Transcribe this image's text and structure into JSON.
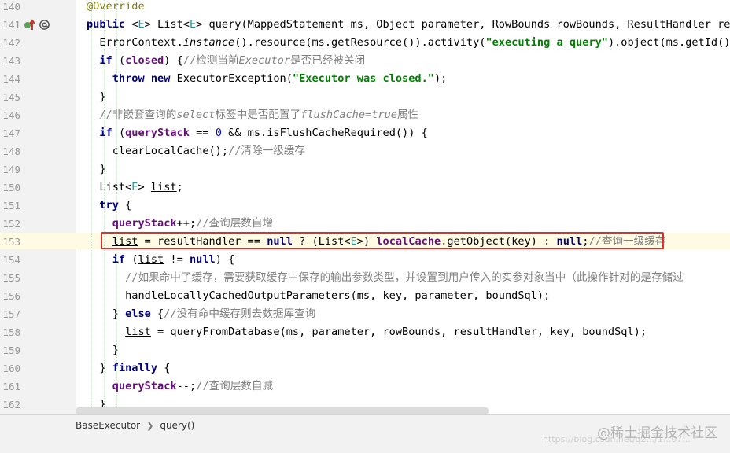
{
  "editor": {
    "lines": [
      {
        "n": "140",
        "segs": [
          {
            "t": "@Override",
            "c": "ann"
          }
        ]
      },
      {
        "n": "141",
        "segs": [
          {
            "t": "public ",
            "c": "kw"
          },
          {
            "t": "<",
            "c": ""
          },
          {
            "t": "E",
            "c": "gen"
          },
          {
            "t": "> List<",
            "c": ""
          },
          {
            "t": "E",
            "c": "gen"
          },
          {
            "t": "> query(MappedStatement ms, Object parameter, RowBounds rowBounds, ResultHandler resul",
            "c": ""
          }
        ]
      },
      {
        "n": "142",
        "segs": [
          {
            "t": "  ErrorContext.",
            "c": ""
          },
          {
            "t": "instance",
            "c": "it"
          },
          {
            "t": "().resource(ms.getResource()).activity(",
            "c": ""
          },
          {
            "t": "\"executing a query\"",
            "c": "str"
          },
          {
            "t": ").object(ms.getId());",
            "c": ""
          }
        ]
      },
      {
        "n": "143",
        "segs": [
          {
            "t": "  ",
            "c": ""
          },
          {
            "t": "if ",
            "c": "kw"
          },
          {
            "t": "(",
            "c": ""
          },
          {
            "t": "closed",
            "c": "fld"
          },
          {
            "t": ") {",
            "c": ""
          },
          {
            "t": "//检测当前",
            "c": "cmz"
          },
          {
            "t": "Executor",
            "c": "cm"
          },
          {
            "t": "是否已经被关闭",
            "c": "cmz"
          }
        ]
      },
      {
        "n": "144",
        "segs": [
          {
            "t": "    ",
            "c": ""
          },
          {
            "t": "throw new ",
            "c": "kw"
          },
          {
            "t": "ExecutorException(",
            "c": ""
          },
          {
            "t": "\"Executor was closed.\"",
            "c": "str"
          },
          {
            "t": ");",
            "c": ""
          }
        ]
      },
      {
        "n": "145",
        "segs": [
          {
            "t": "  }",
            "c": ""
          }
        ]
      },
      {
        "n": "146",
        "segs": [
          {
            "t": "  //非嵌套查询的",
            "c": "cmz"
          },
          {
            "t": "select",
            "c": "cm"
          },
          {
            "t": "标签中是否配置了",
            "c": "cmz"
          },
          {
            "t": "flushCache=true",
            "c": "cm"
          },
          {
            "t": "属性",
            "c": "cmz"
          }
        ]
      },
      {
        "n": "147",
        "segs": [
          {
            "t": "  ",
            "c": ""
          },
          {
            "t": "if ",
            "c": "kw"
          },
          {
            "t": "(",
            "c": ""
          },
          {
            "t": "queryStack",
            "c": "fld"
          },
          {
            "t": " == ",
            "c": ""
          },
          {
            "t": "0",
            "c": "num"
          },
          {
            "t": " && ms.isFlushCacheRequired()) {",
            "c": ""
          }
        ]
      },
      {
        "n": "148",
        "segs": [
          {
            "t": "    clearLocalCache();",
            "c": ""
          },
          {
            "t": "//清除一级缓存",
            "c": "cmz"
          }
        ]
      },
      {
        "n": "149",
        "segs": [
          {
            "t": "  }",
            "c": ""
          }
        ]
      },
      {
        "n": "150",
        "segs": [
          {
            "t": "  List<",
            "c": ""
          },
          {
            "t": "E",
            "c": "gen"
          },
          {
            "t": "> ",
            "c": ""
          },
          {
            "t": "list",
            "c": "ul"
          },
          {
            "t": ";",
            "c": ""
          }
        ]
      },
      {
        "n": "151",
        "segs": [
          {
            "t": "  ",
            "c": ""
          },
          {
            "t": "try ",
            "c": "kw"
          },
          {
            "t": "{",
            "c": ""
          }
        ]
      },
      {
        "n": "152",
        "segs": [
          {
            "t": "    ",
            "c": ""
          },
          {
            "t": "queryStack",
            "c": "fld"
          },
          {
            "t": "++;",
            "c": ""
          },
          {
            "t": "//查询层数自增",
            "c": "cmz"
          }
        ]
      },
      {
        "n": "153",
        "segs": [
          {
            "t": "    ",
            "c": ""
          },
          {
            "t": "list",
            "c": "ul"
          },
          {
            "t": " = resultHandler == ",
            "c": ""
          },
          {
            "t": "null",
            "c": "kw"
          },
          {
            "t": " ? (List<",
            "c": ""
          },
          {
            "t": "E",
            "c": "gen"
          },
          {
            "t": ">) ",
            "c": ""
          },
          {
            "t": "localCache",
            "c": "fld"
          },
          {
            "t": ".getObject(key) : ",
            "c": ""
          },
          {
            "t": "null",
            "c": "kw"
          },
          {
            "t": ";",
            "c": ""
          },
          {
            "t": "//查询一级缓存",
            "c": "cmz"
          }
        ]
      },
      {
        "n": "154",
        "segs": [
          {
            "t": "    ",
            "c": ""
          },
          {
            "t": "if ",
            "c": "kw"
          },
          {
            "t": "(",
            "c": ""
          },
          {
            "t": "list",
            "c": "ul"
          },
          {
            "t": " != ",
            "c": ""
          },
          {
            "t": "null",
            "c": "kw"
          },
          {
            "t": ") {",
            "c": ""
          }
        ]
      },
      {
        "n": "155",
        "segs": [
          {
            "t": "      //如果命中了缓存，需要获取缓存中保存的输出参数类型，并设置到用户传入的实参对象当中（此操作针对的是存储过",
            "c": "cmz"
          }
        ]
      },
      {
        "n": "156",
        "segs": [
          {
            "t": "      handleLocallyCachedOutputParameters(ms, key, parameter, boundSql);",
            "c": ""
          }
        ]
      },
      {
        "n": "157",
        "segs": [
          {
            "t": "    } ",
            "c": ""
          },
          {
            "t": "else ",
            "c": "kw"
          },
          {
            "t": "{",
            "c": ""
          },
          {
            "t": "//没有命中缓存则去数据库查询",
            "c": "cmz"
          }
        ]
      },
      {
        "n": "158",
        "segs": [
          {
            "t": "      ",
            "c": ""
          },
          {
            "t": "list",
            "c": "ul"
          },
          {
            "t": " = queryFromDatabase(ms, parameter, rowBounds, resultHandler, key, boundSql);",
            "c": ""
          }
        ]
      },
      {
        "n": "159",
        "segs": [
          {
            "t": "    }",
            "c": ""
          }
        ]
      },
      {
        "n": "160",
        "segs": [
          {
            "t": "  } ",
            "c": ""
          },
          {
            "t": "finally ",
            "c": "kw"
          },
          {
            "t": "{",
            "c": ""
          }
        ]
      },
      {
        "n": "161",
        "segs": [
          {
            "t": "    ",
            "c": ""
          },
          {
            "t": "queryStack",
            "c": "fld"
          },
          {
            "t": "--;",
            "c": ""
          },
          {
            "t": "//查询层数自减",
            "c": "cmz"
          }
        ]
      },
      {
        "n": "162",
        "segs": [
          {
            "t": "  }",
            "c": ""
          }
        ]
      }
    ]
  },
  "gutter": {
    "icons": [
      "override-arrow-icon",
      "at-annotation-icon"
    ]
  },
  "breadcrumb": {
    "items": [
      "BaseExecutor",
      "query()"
    ]
  },
  "watermark": {
    "text": "@稀土掘金技术社区",
    "url": "https://blog.csdn.net/q2.../1...07..."
  },
  "colors": {
    "highlight": "#d9322f",
    "keyword": "#000080",
    "string": "#008000",
    "field": "#660e7a",
    "comment": "#808080"
  }
}
